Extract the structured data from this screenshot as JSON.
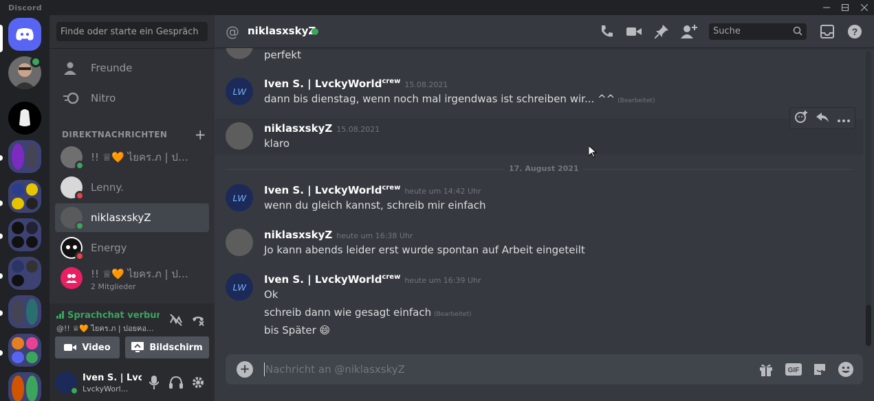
{
  "window": {
    "title": "Discord"
  },
  "search": {
    "placeholder": "Finde oder starte ein Gespräch"
  },
  "nav": [
    {
      "label": "Freunde",
      "icon": "friends-icon"
    },
    {
      "label": "Nitro",
      "icon": "nitro-icon"
    }
  ],
  "dm_section": {
    "title": "DIREKTNACHRICHTEN"
  },
  "dms": [
    {
      "name": "!! ♕🧡 ไยคร.ภ | ปอ...",
      "status": "online"
    },
    {
      "name": "Lenny.",
      "status": "dnd"
    },
    {
      "name": "niklasxskyZ",
      "status": "online",
      "active": true
    },
    {
      "name": "Energy",
      "status": "dnd"
    },
    {
      "name": "!! ♕🧡 ไยคร.ภ | ปอ...",
      "sub": "2 Mitglieder",
      "group": true
    }
  ],
  "voice": {
    "status": "Sprachchat verbunden",
    "channel": "@!! ♕🧡 ไยคร.ภ | ปอยคอ...",
    "video_label": "Video",
    "screen_label": "Bildschirm"
  },
  "user": {
    "name": "Iven S. | Lvc...",
    "status": "LvckyWorl..."
  },
  "chat": {
    "recipient": "niklasxskyZ",
    "search_placeholder": "Suche",
    "composer_placeholder": "Nachricht an @niklasxskyZ",
    "date_divider": "17. August 2021"
  },
  "messages": [
    {
      "type": "cont",
      "text": "perfekt"
    },
    {
      "author": "Iven S. | LvckyWorld",
      "tag": "crew",
      "time": "15.08.2021",
      "text": "dann bis dienstag, wenn noch mal irgendwas ist schreiben wir... ^^",
      "edited": "(Bearbeitet)"
    },
    {
      "author": "niklasxskyZ",
      "time": "15.08.2021",
      "text": "klaro"
    },
    {
      "author": "Iven S. | LvckyWorld",
      "tag": "crew",
      "time": "heute um 14:42 Uhr",
      "text": "wenn du gleich kannst, schreib mir einfach"
    },
    {
      "author": "niklasxskyZ",
      "time": "heute um 16:38 Uhr",
      "text": "Jo kann abends leider erst wurde spontan auf Arbeit eingeteilt"
    },
    {
      "author": "Iven S. | LvckyWorld",
      "tag": "crew",
      "time": "heute um 16:39 Uhr",
      "lines": [
        "Ok",
        "schreib dann wie gesagt einfach",
        "bis Später 😄"
      ],
      "edited": "(Bearbeitet)"
    }
  ],
  "colors": {
    "blurple": "#5865f2",
    "online": "#3ba55d",
    "dnd": "#ed4245",
    "bg_main": "#36393f",
    "bg_side": "#2f3136",
    "bg_rail": "#202225"
  }
}
